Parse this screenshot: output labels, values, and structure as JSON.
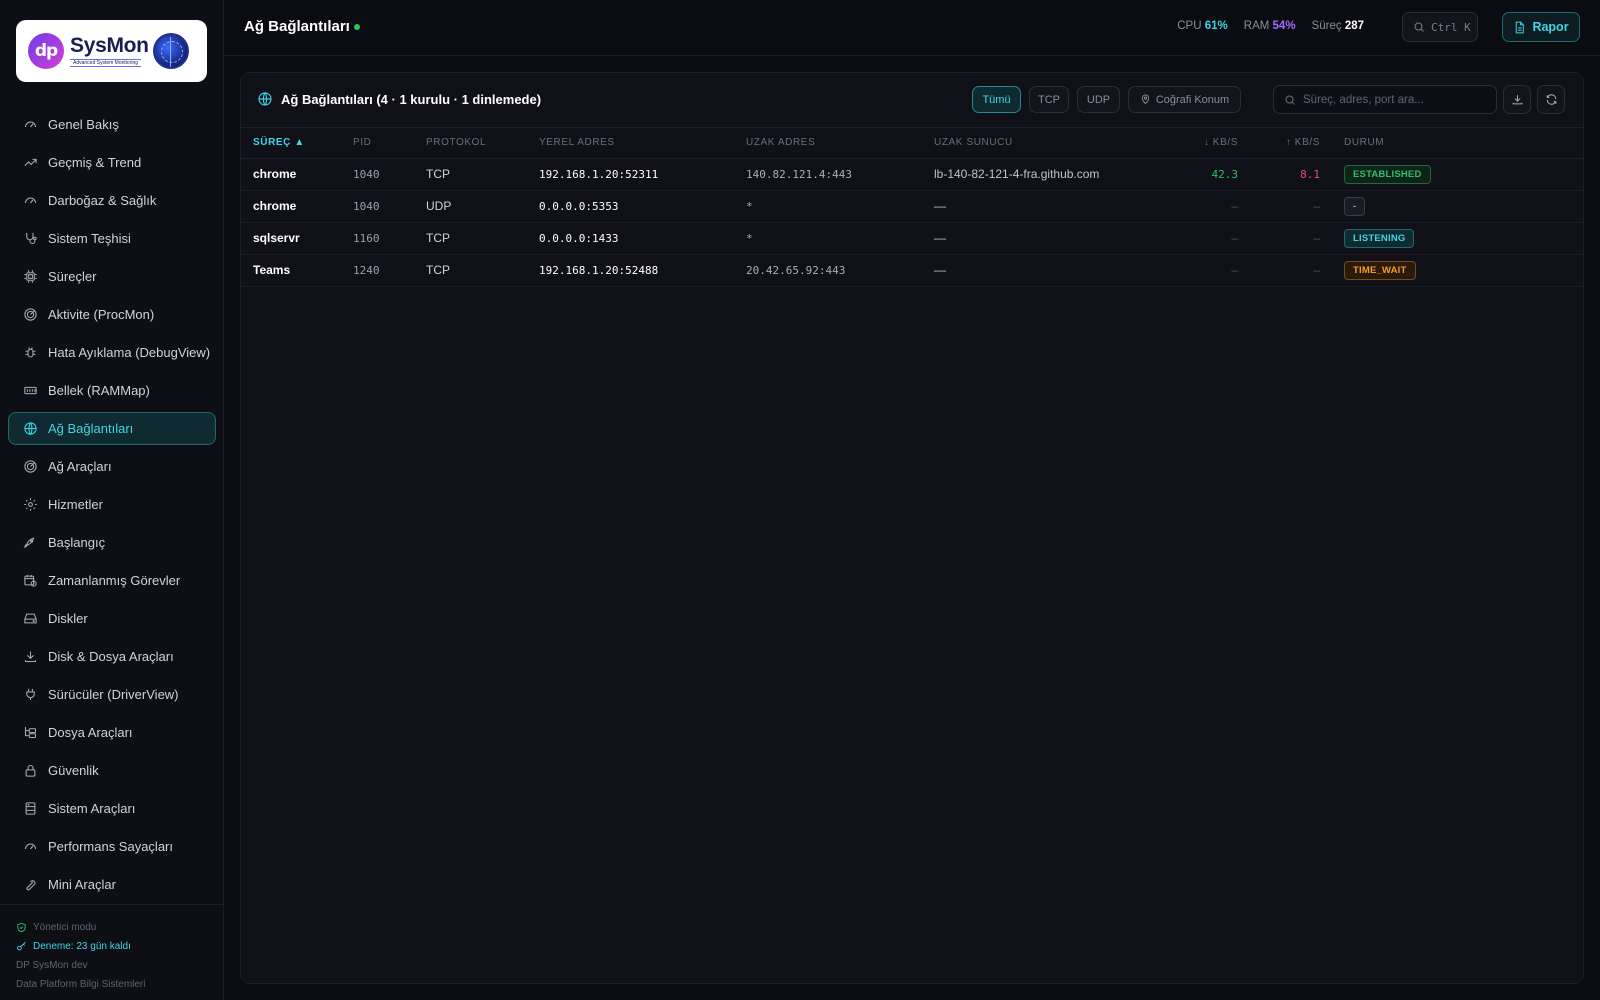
{
  "brand": {
    "name": "SysMon",
    "mark": "dp",
    "tagline": "Advanced System Monitoring"
  },
  "sidebar": {
    "items": [
      {
        "label": "Genel Bakış",
        "icon": "gauge-icon"
      },
      {
        "label": "Geçmiş & Trend",
        "icon": "trend-icon"
      },
      {
        "label": "Darboğaz & Sağlık",
        "icon": "gauge-icon"
      },
      {
        "label": "Sistem Teşhisi",
        "icon": "stethoscope-icon"
      },
      {
        "label": "Süreçler",
        "icon": "cpu-icon"
      },
      {
        "label": "Aktivite (ProcMon)",
        "icon": "radar-icon"
      },
      {
        "label": "Hata Ayıklama (DebugView)",
        "icon": "bug-icon"
      },
      {
        "label": "Bellek (RAMMap)",
        "icon": "memory-icon"
      },
      {
        "label": "Ağ Bağlantıları",
        "icon": "globe-icon",
        "active": true
      },
      {
        "label": "Ağ Araçları",
        "icon": "radar-icon"
      },
      {
        "label": "Hizmetler",
        "icon": "cog-icon"
      },
      {
        "label": "Başlangıç",
        "icon": "rocket-icon"
      },
      {
        "label": "Zamanlanmış Görevler",
        "icon": "calendar-clock-icon"
      },
      {
        "label": "Diskler",
        "icon": "drive-icon"
      },
      {
        "label": "Disk & Dosya Araçları",
        "icon": "download-icon"
      },
      {
        "label": "Sürücüler (DriverView)",
        "icon": "plug-icon"
      },
      {
        "label": "Dosya Araçları",
        "icon": "folder-tree-icon"
      },
      {
        "label": "Güvenlik",
        "icon": "lock-icon"
      },
      {
        "label": "Sistem Araçları",
        "icon": "server-icon"
      },
      {
        "label": "Performans Sayaçları",
        "icon": "gauge-icon"
      },
      {
        "label": "Mini Araçlar",
        "icon": "wrench-icon"
      }
    ],
    "footer": {
      "admin": "Yönetici modu",
      "trial": "Deneme: 23 gün kaldı",
      "version": "DP SysMon dev",
      "company": "Data Platform Bilgi Sistemleri"
    }
  },
  "header": {
    "title": "Ağ Bağlantıları",
    "cpu_label": "CPU",
    "cpu_value": "61%",
    "ram_label": "RAM",
    "ram_value": "54%",
    "proc_label": "Süreç",
    "proc_value": "287",
    "search_shortcut": "Ctrl K",
    "report_label": "Rapor"
  },
  "panel": {
    "title": "Ağ Bağlantıları (4 · 1 kurulu · 1 dinlemede)",
    "filters": {
      "all": "Tümü",
      "tcp": "TCP",
      "udp": "UDP",
      "geo": "Coğrafi Konum"
    },
    "search_placeholder": "Süreç, adres, port ara..."
  },
  "table": {
    "columns": [
      "SÜREÇ ▲",
      "PID",
      "PROTOKOL",
      "YEREL ADRES",
      "UZAK ADRES",
      "UZAK SUNUCU",
      "↓ KB/S",
      "↑ KB/S",
      "DURUM"
    ],
    "rows": [
      {
        "process": "chrome",
        "pid": "1040",
        "protocol": "TCP",
        "local": "192.168.1.20:52311",
        "remote": "140.82.121.4:443",
        "host": "lb-140-82-121-4-fra.github.com",
        "down": "42.3",
        "up": "8.1",
        "state": "ESTABLISHED",
        "state_kind": "est"
      },
      {
        "process": "chrome",
        "pid": "1040",
        "protocol": "UDP",
        "local": "0.0.0.0:5353",
        "remote": "*",
        "host": "—",
        "down": "–",
        "up": "–",
        "state": "-",
        "state_kind": "none"
      },
      {
        "process": "sqlservr",
        "pid": "1160",
        "protocol": "TCP",
        "local": "0.0.0.0:1433",
        "remote": "*",
        "host": "—",
        "down": "–",
        "up": "–",
        "state": "LISTENING",
        "state_kind": "listen"
      },
      {
        "process": "Teams",
        "pid": "1240",
        "protocol": "TCP",
        "local": "192.168.1.20:52488",
        "remote": "20.42.65.92:443",
        "host": "—",
        "down": "–",
        "up": "–",
        "state": "TIME_WAIT",
        "state_kind": "wait"
      }
    ]
  },
  "colors": {
    "accent": "#3fd6e4",
    "ram": "#a46cff",
    "ok": "#2fbf6a",
    "upload": "#e84a8a",
    "warn": "#f59a2a"
  }
}
